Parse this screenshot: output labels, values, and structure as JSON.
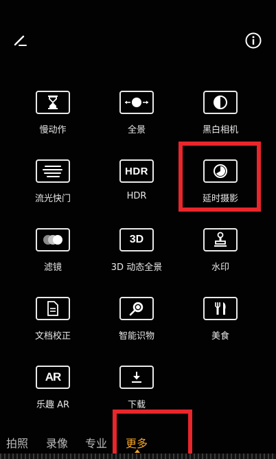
{
  "top_bar": {
    "edit_icon": "pencil-edit-icon",
    "info_icon": "info-circle-icon"
  },
  "modes": [
    {
      "label": "慢动作",
      "icon": "hourglass-icon"
    },
    {
      "label": "全景",
      "icon": "panorama-icon"
    },
    {
      "label": "黑白相机",
      "icon": "monochrome-icon"
    },
    {
      "label": "流光快门",
      "icon": "light-trail-icon"
    },
    {
      "label": "HDR",
      "icon": "hdr-icon",
      "icon_text": "HDR"
    },
    {
      "label": "延时摄影",
      "icon": "timelapse-icon"
    },
    {
      "label": "滤镜",
      "icon": "filter-icon"
    },
    {
      "label": "3D 动态全景",
      "icon": "3d-icon",
      "icon_text": "3D"
    },
    {
      "label": "水印",
      "icon": "watermark-stamp-icon"
    },
    {
      "label": "文档校正",
      "icon": "document-icon"
    },
    {
      "label": "智能识物",
      "icon": "magnifier-icon"
    },
    {
      "label": "美食",
      "icon": "fork-knife-icon"
    },
    {
      "label": "乐趣 AR",
      "icon": "ar-icon",
      "icon_text": "AR"
    },
    {
      "label": "下载",
      "icon": "download-icon"
    }
  ],
  "bottom_nav": {
    "items": [
      "拍照",
      "录像",
      "专业",
      "更多"
    ],
    "active": "更多"
  },
  "colors": {
    "background": "#020202",
    "highlight": "#e8262b",
    "active_tab": "#f5a322"
  }
}
